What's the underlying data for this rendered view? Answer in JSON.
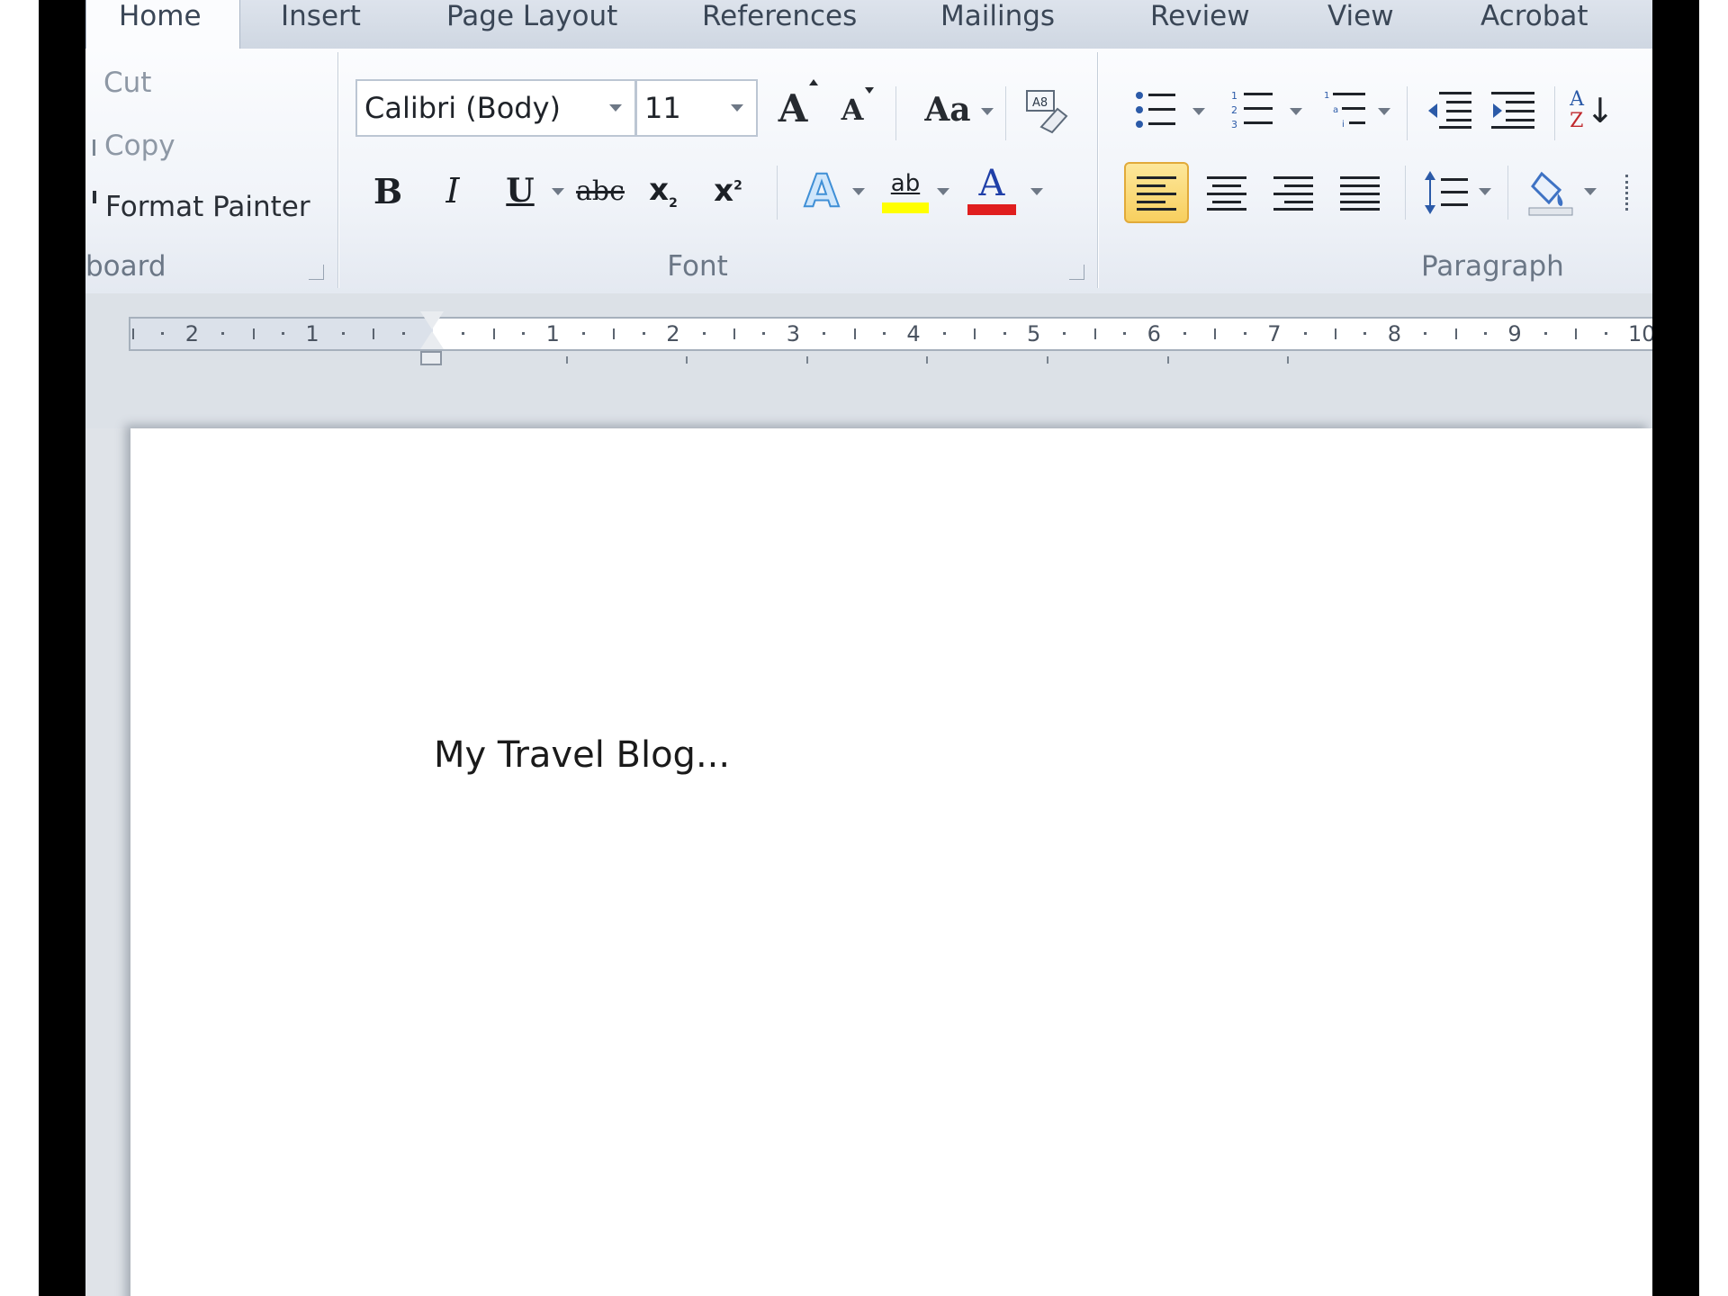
{
  "tabs": [
    {
      "label": "Home",
      "active": true
    },
    {
      "label": "Insert",
      "active": false
    },
    {
      "label": "Page Layout",
      "active": false
    },
    {
      "label": "References",
      "active": false
    },
    {
      "label": "Mailings",
      "active": false
    },
    {
      "label": "Review",
      "active": false
    },
    {
      "label": "View",
      "active": false
    },
    {
      "label": "Acrobat",
      "active": false
    }
  ],
  "clipboard": {
    "cut": "Cut",
    "copy": "Copy",
    "format_painter": "Format Painter",
    "label": "board"
  },
  "font": {
    "name": "Calibri (Body)",
    "size": "11",
    "label": "Font",
    "change_case": "Aa",
    "grow": "A",
    "shrink": "A",
    "bold": "B",
    "italic": "I",
    "underline": "U",
    "strike": "abc",
    "subscript": "x",
    "sub_mark": "2",
    "superscript": "x",
    "sup_mark": "2",
    "text_effects": "A",
    "highlight": "ab",
    "font_color": "A",
    "highlight_color": "#ffff00",
    "font_color_value": "#e01e1e"
  },
  "paragraph": {
    "label": "Paragraph",
    "sort_a": "A",
    "sort_z": "Z"
  },
  "ruler": {
    "left_labels": [
      "2",
      "1"
    ],
    "right_labels": [
      "1",
      "2",
      "3",
      "4",
      "5",
      "6",
      "7",
      "8",
      "9",
      "10"
    ]
  },
  "document": {
    "text": "My Travel Blog..."
  },
  "colors": {
    "accent_selected": "#f8cf5f",
    "frame": "#000000"
  }
}
